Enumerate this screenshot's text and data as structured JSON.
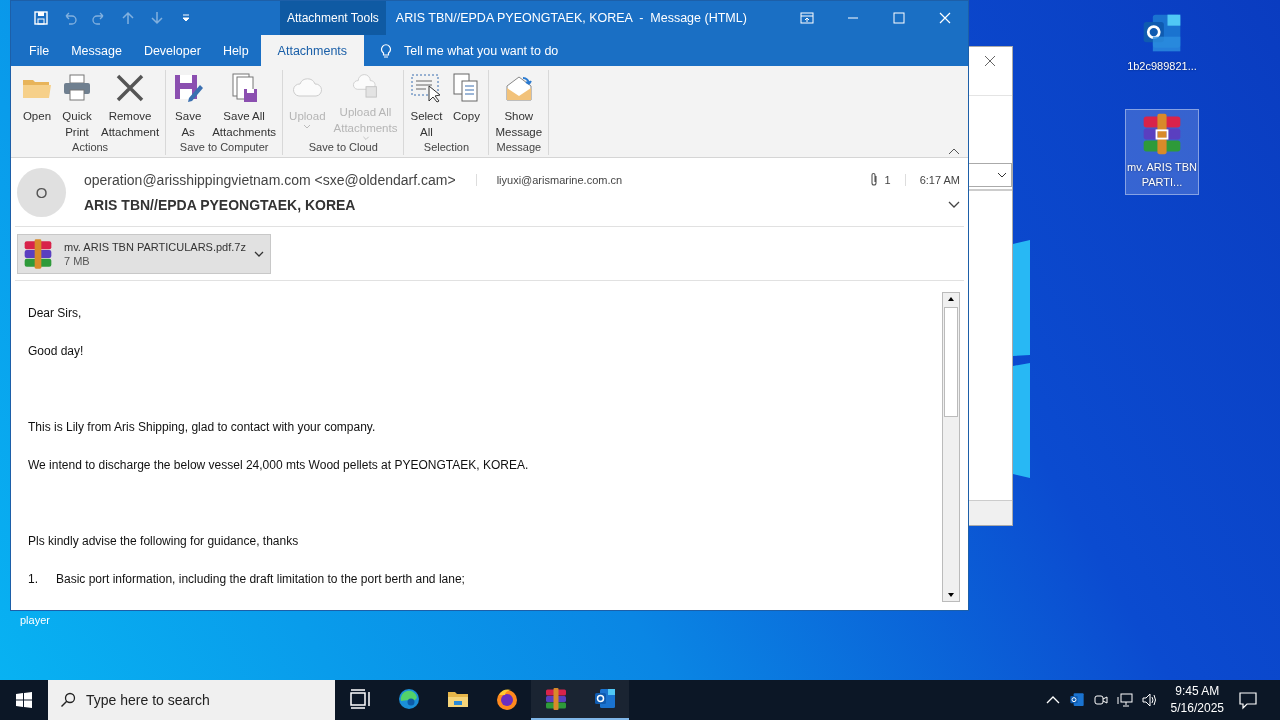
{
  "desktop": {
    "icons": [
      {
        "label": "1b2c989821...",
        "kind": "outlook",
        "selected": false
      },
      {
        "label": "mv. ARIS TBN PARTI...",
        "kind": "archive",
        "selected": true
      }
    ],
    "hidden_icon_label": "player"
  },
  "window": {
    "context_tab": "Attachment Tools",
    "title": "ARIS TBN//EPDA PYEONGTAEK, KOREA  -  Message (HTML)"
  },
  "ribbon_tabs": [
    {
      "label": "File",
      "selected": false
    },
    {
      "label": "Message",
      "selected": false
    },
    {
      "label": "Developer",
      "selected": false
    },
    {
      "label": "Help",
      "selected": false
    },
    {
      "label": "Attachments",
      "selected": true
    }
  ],
  "tell_me": "Tell me what you want to do",
  "ribbon_groups": [
    {
      "label": "Actions",
      "buttons": [
        {
          "label": "Open",
          "kind": "folder",
          "disabled": false,
          "dropdown": false
        },
        {
          "label": "Quick\nPrint",
          "kind": "printer",
          "disabled": false,
          "dropdown": false
        },
        {
          "label": "Remove\nAttachment",
          "kind": "cross",
          "disabled": false,
          "dropdown": false
        }
      ]
    },
    {
      "label": "Save to Computer",
      "buttons": [
        {
          "label": "Save\nAs",
          "kind": "saveas",
          "disabled": false,
          "dropdown": false
        },
        {
          "label": "Save All\nAttachments",
          "kind": "saveall",
          "disabled": false,
          "dropdown": false
        }
      ]
    },
    {
      "label": "Save to Cloud",
      "buttons": [
        {
          "label": "Upload",
          "kind": "cloud",
          "disabled": true,
          "dropdown": true
        },
        {
          "label": "Upload All\nAttachments",
          "kind": "cloudsave",
          "disabled": true,
          "dropdown": true
        }
      ]
    },
    {
      "label": "Selection",
      "buttons": [
        {
          "label": "Select\nAll",
          "kind": "selectall",
          "disabled": false,
          "dropdown": false
        },
        {
          "label": "Copy",
          "kind": "copy",
          "disabled": false,
          "dropdown": false
        }
      ]
    },
    {
      "label": "Message",
      "buttons": [
        {
          "label": "Show\nMessage",
          "kind": "envelope",
          "disabled": false,
          "dropdown": false
        }
      ]
    }
  ],
  "message": {
    "avatar": "O",
    "from": "operation@arisshippingvietnam.com <sxe@oldendarf.cam>",
    "to": "liyuxi@arismarine.com.cn",
    "attachment_count": "1",
    "time": "6:17 AM",
    "subject": "ARIS TBN//EPDA PYEONGTAEK, KOREA"
  },
  "attachment": {
    "name": "mv. ARIS TBN PARTICULARS.pdf.7z",
    "size": "7 MB"
  },
  "body": [
    {
      "kind": "p",
      "text": "Dear Sirs,"
    },
    {
      "kind": "p",
      "text": "Good day!"
    },
    {
      "kind": "blank"
    },
    {
      "kind": "p",
      "text": "This is Lily from Aris Shipping, glad to contact with your company."
    },
    {
      "kind": "p",
      "text": "We intend to discharge the below vessel 24,000  mts Wood pellets at PYEONGTAEK, KOREA."
    },
    {
      "kind": "blank"
    },
    {
      "kind": "p",
      "text": "Pls kindly advise the following for guidance, thanks"
    },
    {
      "kind": "li",
      "number": "1.",
      "text": "Basic port information, including the draft limitation to the port berth and lane;"
    }
  ],
  "taskbar": {
    "search_placeholder": "Type here to search",
    "apps": [
      {
        "kind": "taskview",
        "running": false
      },
      {
        "kind": "edge",
        "running": false
      },
      {
        "kind": "explorer",
        "running": false
      },
      {
        "kind": "firefox",
        "running": false
      },
      {
        "kind": "archive",
        "running": true
      },
      {
        "kind": "outlook",
        "running": true
      }
    ],
    "time": "9:45 AM",
    "date": "5/16/2025"
  }
}
